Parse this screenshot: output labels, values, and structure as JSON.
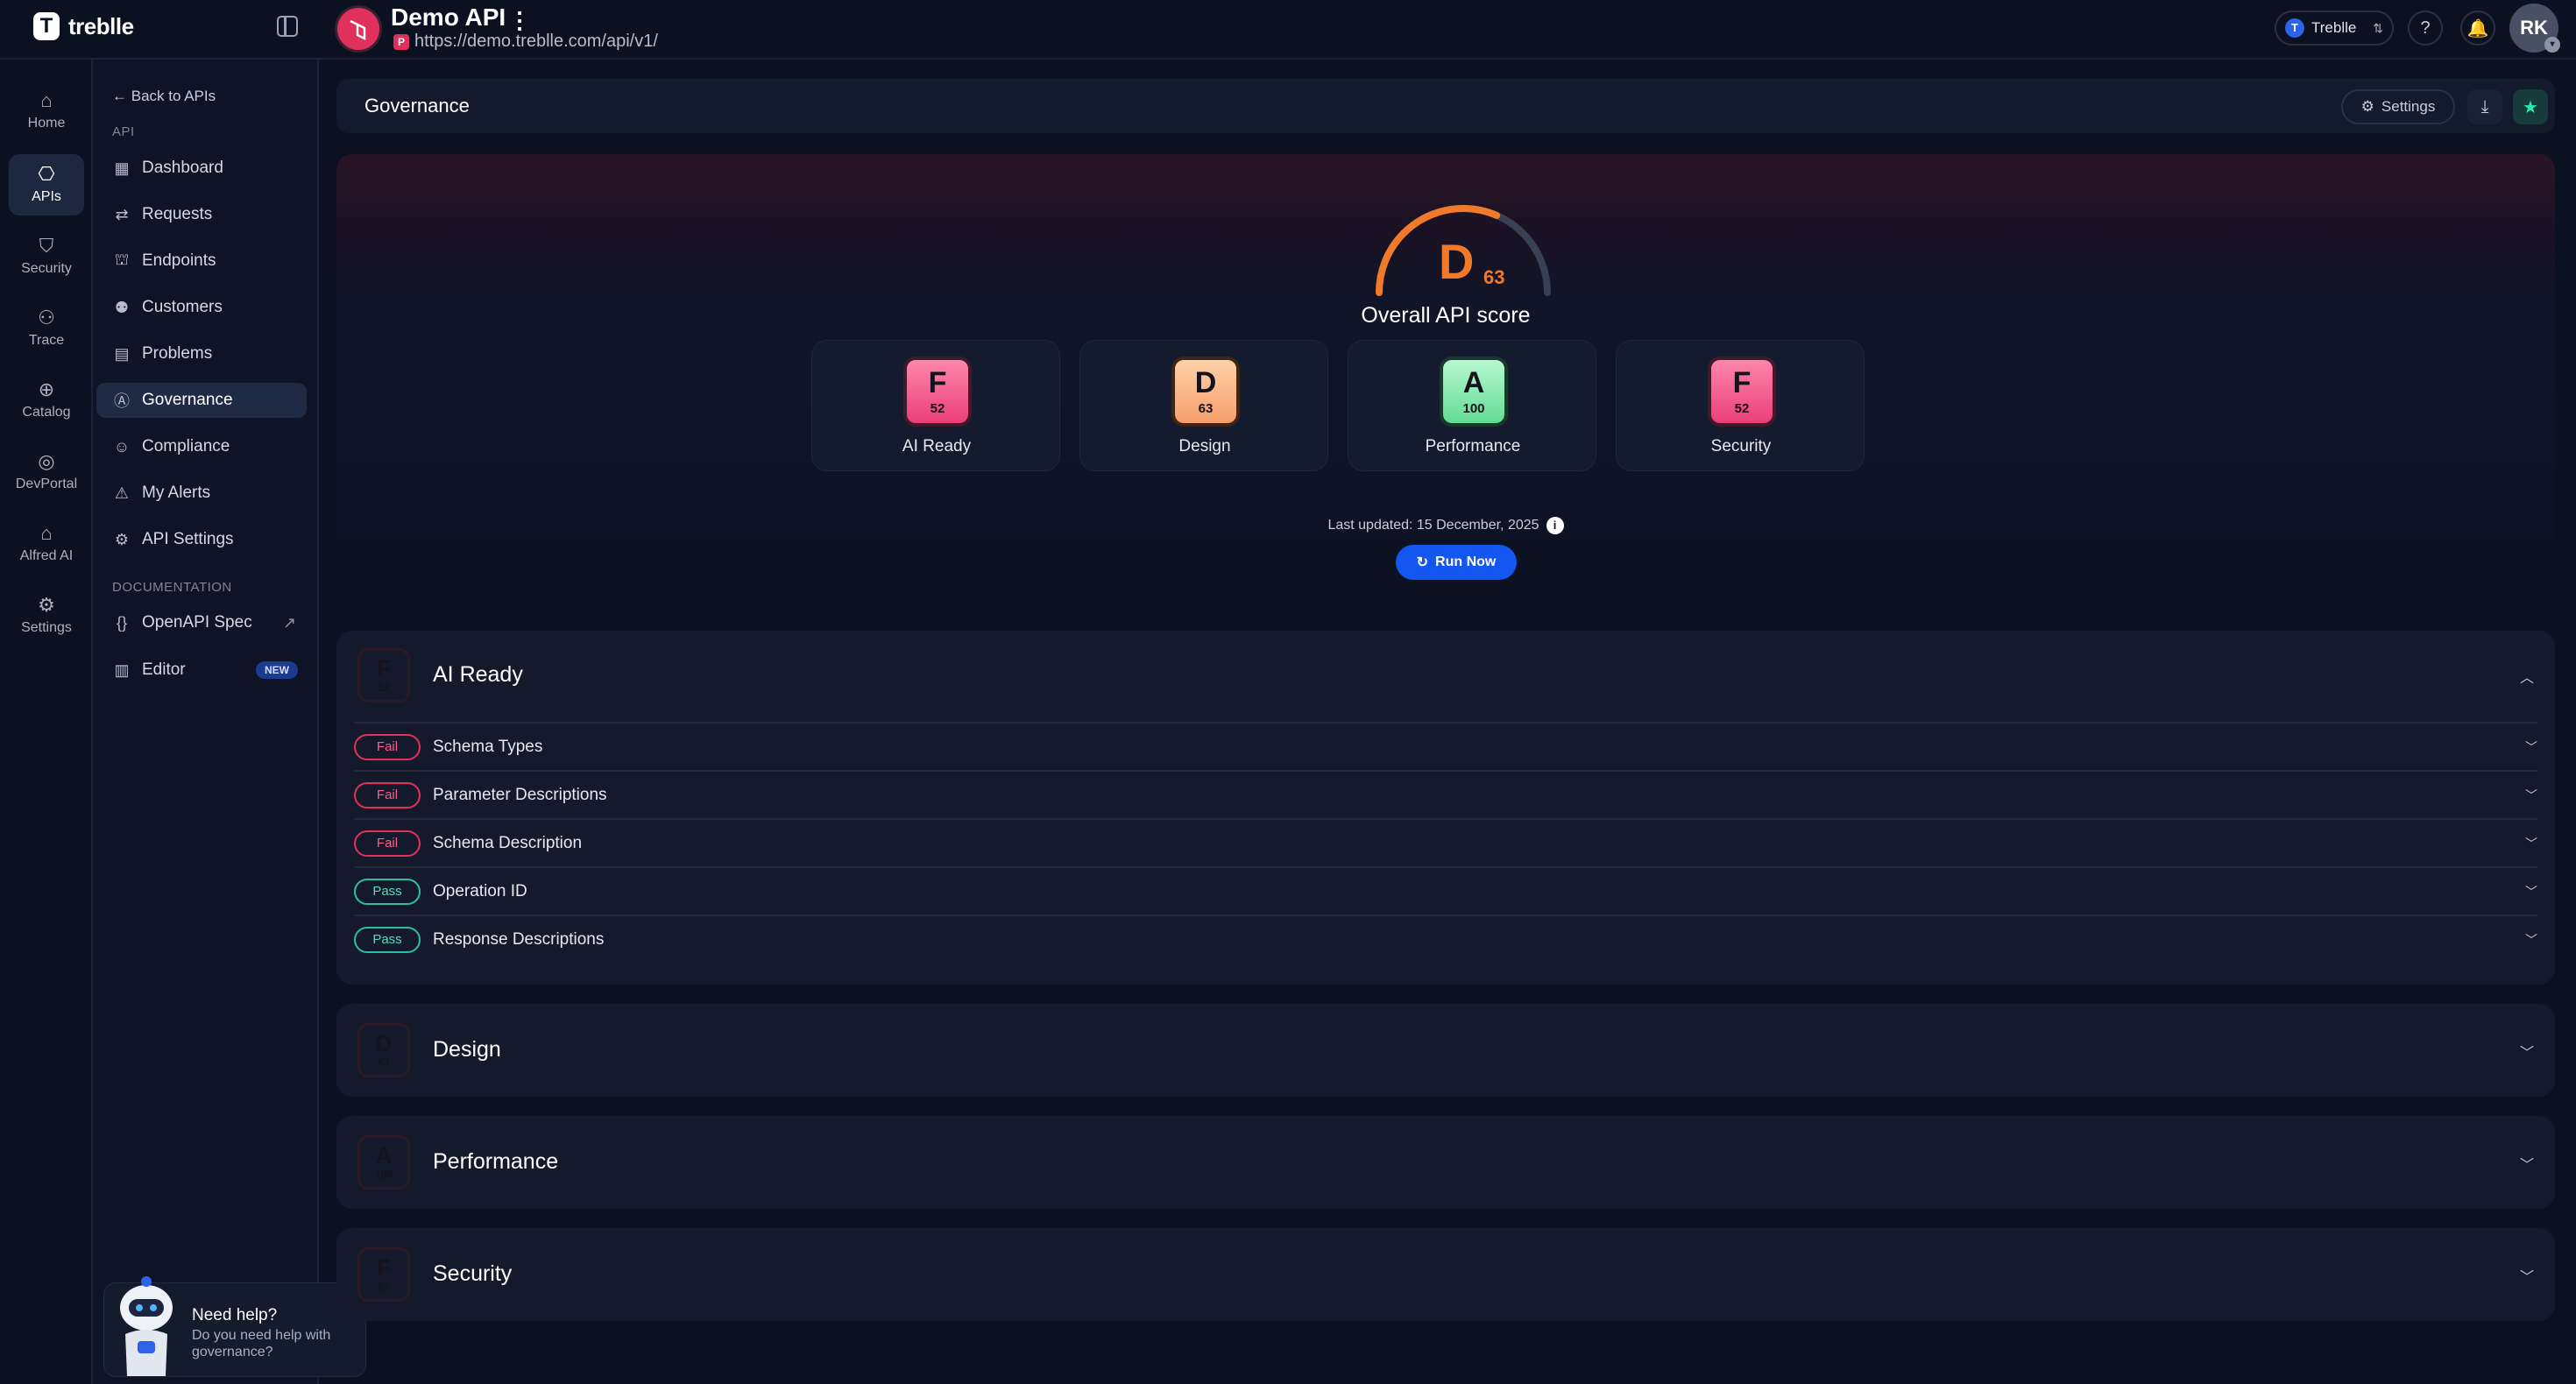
{
  "brand": {
    "name": "treblle"
  },
  "api": {
    "name": "Demo API",
    "url": "https://demo.treblle.com/api/v1/",
    "badge": "P"
  },
  "topbar": {
    "workspace": "Treblle",
    "avatar_initials": "RK"
  },
  "rail": [
    {
      "label": "Home",
      "icon": "home-icon"
    },
    {
      "label": "APIs",
      "icon": "apis-icon"
    },
    {
      "label": "Security",
      "icon": "shield-icon"
    },
    {
      "label": "Trace",
      "icon": "trace-icon"
    },
    {
      "label": "Catalog",
      "icon": "catalog-icon"
    },
    {
      "label": "DevPortal",
      "icon": "devportal-icon"
    },
    {
      "label": "Alfred AI",
      "icon": "robot-icon"
    },
    {
      "label": "Settings",
      "icon": "gear-icon"
    }
  ],
  "sidenav": {
    "back": "Back to APIs",
    "section_api": "API",
    "items": [
      {
        "label": "Dashboard",
        "icon": "dashboard-icon"
      },
      {
        "label": "Requests",
        "icon": "requests-icon"
      },
      {
        "label": "Endpoints",
        "icon": "endpoints-icon"
      },
      {
        "label": "Customers",
        "icon": "customers-icon"
      },
      {
        "label": "Problems",
        "icon": "problems-icon"
      },
      {
        "label": "Governance",
        "icon": "governance-icon"
      },
      {
        "label": "Compliance",
        "icon": "compliance-icon"
      },
      {
        "label": "My Alerts",
        "icon": "alert-icon"
      },
      {
        "label": "API Settings",
        "icon": "gear-icon"
      }
    ],
    "section_docs": "DOCUMENTATION",
    "docs": [
      {
        "label": "OpenAPI Spec",
        "icon": "code-icon"
      },
      {
        "label": "Editor",
        "icon": "editor-icon",
        "badge": "NEW"
      }
    ]
  },
  "help": {
    "title": "Need help?",
    "text": "Do you need help with governance?"
  },
  "page": {
    "title": "Governance",
    "settings_label": "Settings"
  },
  "score": {
    "grade": "D",
    "value": "63",
    "value_fraction": 0.63,
    "caption": "Overall API score",
    "last_updated": "Last updated: 15 December, 2025",
    "run_label": "Run Now",
    "categories": [
      {
        "grade": "F",
        "score": "52",
        "label": "AI Ready",
        "color": "#ea3f78"
      },
      {
        "grade": "D",
        "score": "63",
        "label": "Design",
        "color": "#f59e6b"
      },
      {
        "grade": "A",
        "score": "100",
        "label": "Performance",
        "color": "#63dc95"
      },
      {
        "grade": "F",
        "score": "52",
        "label": "Security",
        "color": "#ea3f78"
      }
    ]
  },
  "sections": {
    "ai_ready": {
      "title": "AI Ready",
      "grade": "F",
      "score": "52",
      "rules": [
        {
          "status": "Fail",
          "name": "Schema Types"
        },
        {
          "status": "Fail",
          "name": "Parameter Descriptions"
        },
        {
          "status": "Fail",
          "name": "Schema Description"
        },
        {
          "status": "Pass",
          "name": "Operation ID"
        },
        {
          "status": "Pass",
          "name": "Response Descriptions"
        }
      ]
    },
    "design": {
      "title": "Design",
      "grade": "D",
      "score": "63"
    },
    "performance": {
      "title": "Performance",
      "grade": "A",
      "score": "100"
    },
    "security": {
      "title": "Security",
      "grade": "F",
      "score": "52"
    }
  },
  "colors": {
    "accent": "#1456f0",
    "fail": "#e0315c",
    "pass": "#2bbfa0",
    "grade_d": "#f07a2a"
  }
}
